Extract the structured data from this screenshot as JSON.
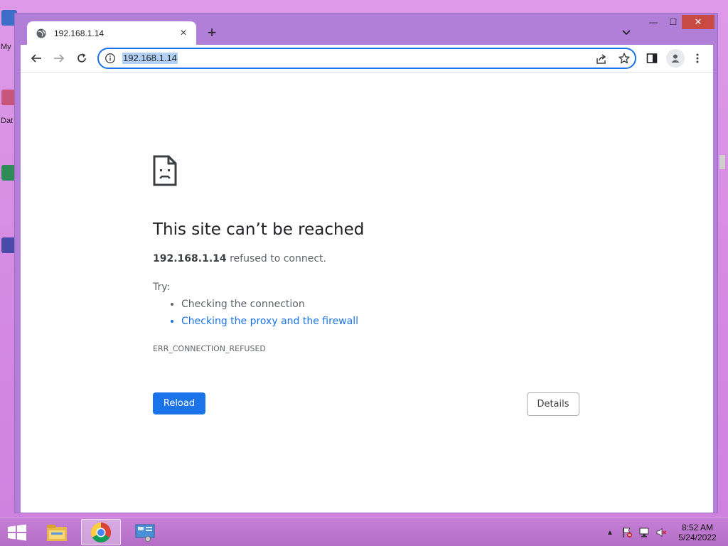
{
  "desktop": {
    "icons": [
      {
        "label": "My",
        "color": "#3b6fc7"
      },
      {
        "label": "Dat",
        "color": "#c8557a"
      },
      {
        "label": "",
        "color": "#2e8b57"
      },
      {
        "label": "",
        "color": "#4a4aa8"
      }
    ]
  },
  "window": {
    "tab": {
      "title": "192.168.1.14",
      "favicon": "globe-icon"
    },
    "controls": {
      "minimize": "—",
      "maximize": "☐",
      "close": "✕"
    }
  },
  "toolbar": {
    "url": "192.168.1.14",
    "buttons": [
      "back-icon",
      "forward-icon",
      "reload-icon",
      "site-info-icon",
      "share-icon",
      "bookmark-star-icon",
      "side-panel-icon",
      "profile-icon",
      "menu-icon"
    ]
  },
  "error_page": {
    "title": "This site can’t be reached",
    "host": "192.168.1.14",
    "message": " refused to connect.",
    "try_label": "Try:",
    "suggestions": [
      {
        "text": "Checking the connection",
        "link": false
      },
      {
        "text": "Checking the proxy and the firewall",
        "link": true
      }
    ],
    "error_code": "ERR_CONNECTION_REFUSED",
    "reload_label": "Reload",
    "details_label": "Details",
    "accent": "#1a73e8"
  },
  "taskbar": {
    "apps": [
      "file-explorer-icon",
      "chrome-icon",
      "control-panel-icon"
    ],
    "active_app": "chrome-icon",
    "tray": [
      "show-hidden-icons",
      "action-center-flag-icon",
      "network-icon",
      "volume-muted-icon"
    ],
    "time": "8:52 AM",
    "date": "5/24/2022"
  }
}
